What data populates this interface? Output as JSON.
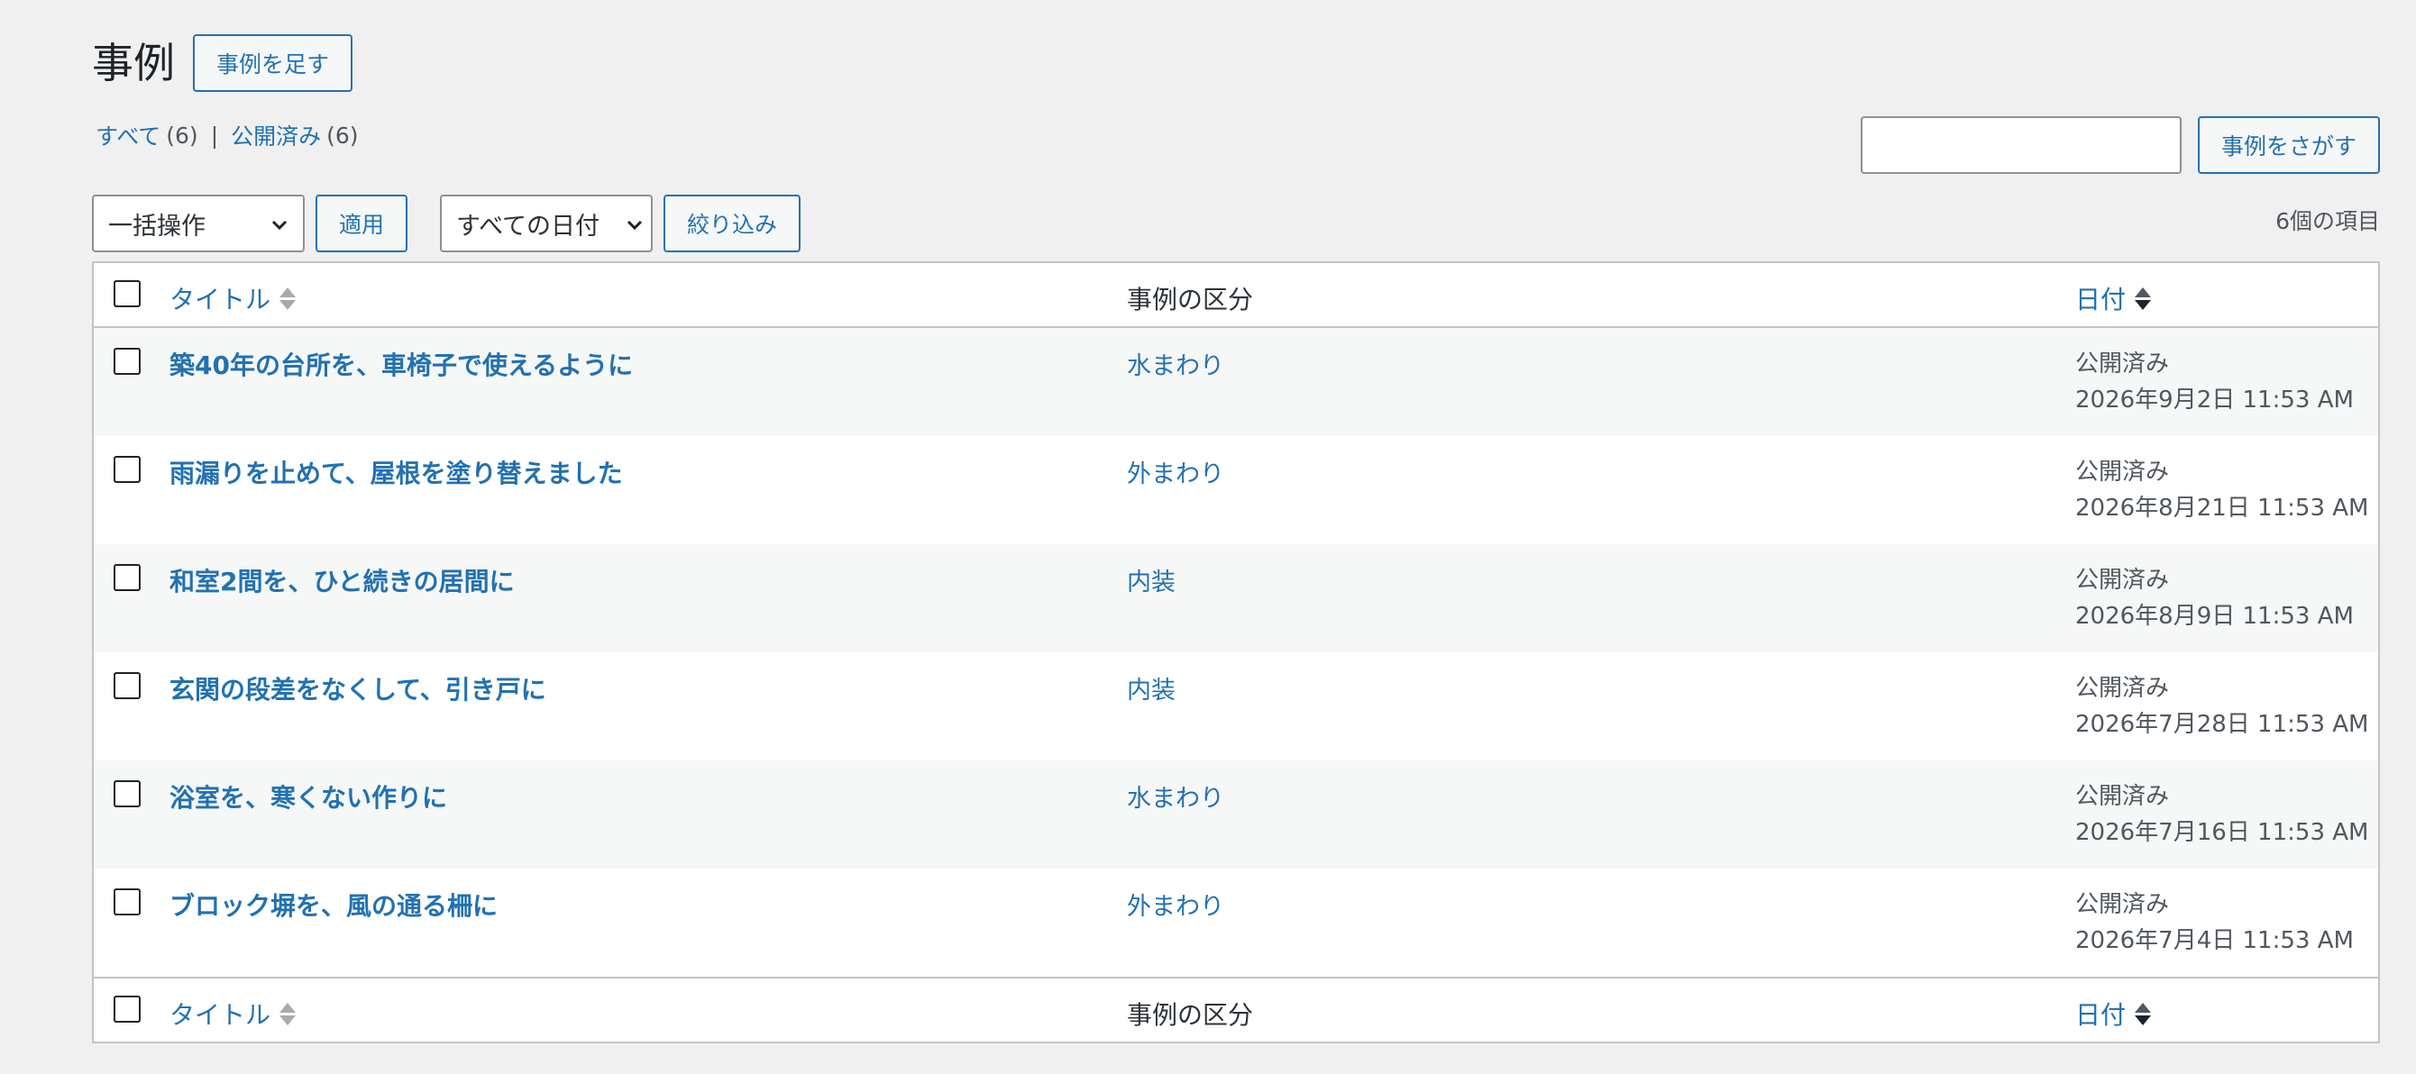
{
  "header": {
    "title": "事例",
    "add_new": "事例を足す"
  },
  "views": [
    {
      "label": "すべて",
      "count": "(6)"
    },
    {
      "label": "公開済み",
      "count": "(6)"
    }
  ],
  "views_separator": "|",
  "search": {
    "button": "事例をさがす",
    "value": ""
  },
  "tablenav": {
    "bulk_action": "一括操作",
    "apply": "適用",
    "date_filter": "すべての日付",
    "filter": "絞り込み",
    "items_count": "6個の項目"
  },
  "columns": {
    "title": "タイトル",
    "category": "事例の区分",
    "date": "日付"
  },
  "rows": [
    {
      "title": "築40年の台所を、車椅子で使えるように",
      "category": "水まわり",
      "status": "公開済み",
      "date": "2026年9月2日 11:53 AM"
    },
    {
      "title": "雨漏りを止めて、屋根を塗り替えました",
      "category": "外まわり",
      "status": "公開済み",
      "date": "2026年8月21日 11:53 AM"
    },
    {
      "title": "和室2間を、ひと続きの居間に",
      "category": "内装",
      "status": "公開済み",
      "date": "2026年8月9日 11:53 AM"
    },
    {
      "title": "玄関の段差をなくして、引き戸に",
      "category": "内装",
      "status": "公開済み",
      "date": "2026年7月28日 11:53 AM"
    },
    {
      "title": "浴室を、寒くない作りに",
      "category": "水まわり",
      "status": "公開済み",
      "date": "2026年7月16日 11:53 AM"
    },
    {
      "title": "ブロック塀を、風の通る柵に",
      "category": "外まわり",
      "status": "公開済み",
      "date": "2026年7月4日 11:53 AM"
    }
  ],
  "colors": {
    "link": "#2271b1",
    "background": "#f0f0f1",
    "table_border": "#c3c4c7"
  }
}
